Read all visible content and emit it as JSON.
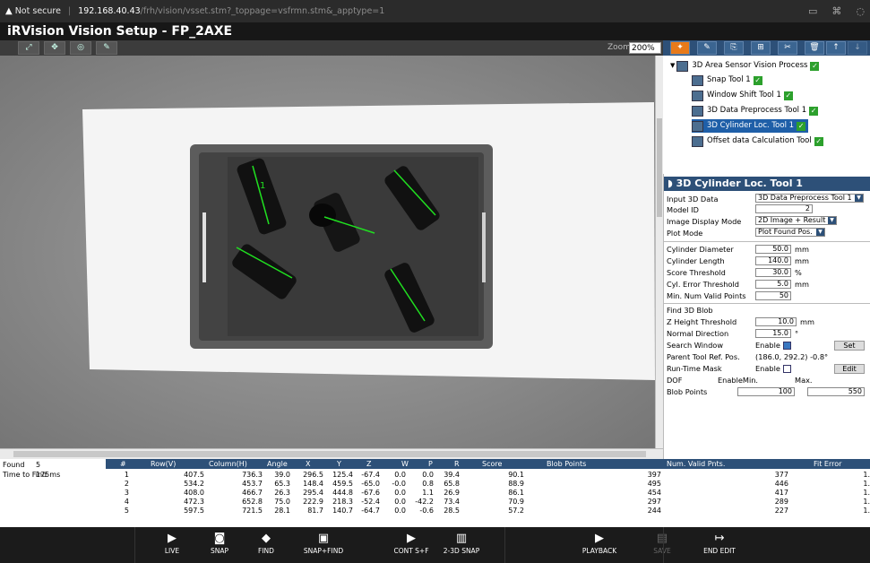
{
  "browser": {
    "not_secure": "Not secure",
    "host": "192.168.40.43",
    "path": "/frh/vision/vsset.stm?_toppage=vsfrmn.stm&_apptype=1"
  },
  "app": {
    "title": "iRVision Vision Setup - FP_2AXE"
  },
  "toolbar": {
    "zoom_label": "Zoom",
    "zoom_value": "200%"
  },
  "tree": {
    "root": "3D Area Sensor Vision Process",
    "items": [
      "Snap Tool 1",
      "Window Shift Tool 1",
      "3D Data Preprocess Tool 1",
      "3D Cylinder Loc. Tool 1",
      "Offset data Calculation Tool"
    ]
  },
  "panel": {
    "title": "3D Cylinder Loc. Tool 1",
    "input_3d_data_label": "Input 3D Data",
    "input_3d_data_value": "3D Data Preprocess Tool 1",
    "model_id_label": "Model ID",
    "model_id_value": "2",
    "image_display_mode_label": "Image Display Mode",
    "image_display_mode_value": "2D Image + Result",
    "plot_mode_label": "Plot Mode",
    "plot_mode_value": "Plot Found Pos.",
    "cyl_diameter_label": "Cylinder Diameter",
    "cyl_diameter_value": "50.0",
    "cyl_length_label": "Cylinder Length",
    "cyl_length_value": "140.0",
    "score_threshold_label": "Score Threshold",
    "score_threshold_value": "30.0",
    "cyl_error_label": "Cyl. Error Threshold",
    "cyl_error_value": "5.0",
    "min_valid_label": "Min. Num Valid Points",
    "min_valid_value": "50",
    "find_3d_blob_label": "Find 3D Blob",
    "z_height_label": "Z Height Threshold",
    "z_height_value": "10.0",
    "normal_dir_label": "Normal Direction",
    "normal_dir_value": "15.0",
    "search_window_label": "Search Window",
    "enable_label": "Enable",
    "set_button": "Set",
    "parent_ref_label": "Parent Tool Ref. Pos.",
    "parent_ref_value": "(186.0, 292.2) -0.8°",
    "runtime_mask_label": "Run-Time Mask",
    "edit_button": "Edit",
    "dof_label": "DOF",
    "enable_min_label": "EnableMin.",
    "max_label": "Max.",
    "blob_points_label": "Blob Points",
    "blob_min_value": "100",
    "blob_max_value": "550",
    "unit_mm": "mm",
    "unit_pct": "%",
    "unit_deg": "°"
  },
  "results": {
    "found_label": "Found",
    "found_value": "5",
    "time_label": "Time to Find",
    "time_value": "175ms",
    "headers": [
      "#",
      "Row(V)",
      "Column(H)",
      "Angle",
      "X",
      "Y",
      "Z",
      "W",
      "P",
      "R",
      "Score",
      "Blob Points",
      "Num. Valid Pnts.",
      "Fit Error"
    ],
    "rows": [
      [
        "1",
        "407.5",
        "736.3",
        "39.0",
        "296.5",
        "125.4",
        "-67.4",
        "0.0",
        "0.0",
        "39.4",
        "90.1",
        "397",
        "377",
        "1."
      ],
      [
        "2",
        "534.2",
        "453.7",
        "65.3",
        "148.4",
        "459.5",
        "-65.0",
        "-0.0",
        "0.8",
        "65.8",
        "88.9",
        "495",
        "446",
        "1."
      ],
      [
        "3",
        "408.0",
        "466.7",
        "26.3",
        "295.4",
        "444.8",
        "-67.6",
        "0.0",
        "1.1",
        "26.9",
        "86.1",
        "454",
        "417",
        "1."
      ],
      [
        "4",
        "472.3",
        "652.8",
        "75.0",
        "222.9",
        "218.3",
        "-52.4",
        "0.0",
        "-42.2",
        "73.4",
        "70.9",
        "297",
        "289",
        "1."
      ],
      [
        "5",
        "597.5",
        "721.5",
        "28.1",
        "81.7",
        "140.7",
        "-64.7",
        "0.0",
        "-0.6",
        "28.5",
        "57.2",
        "244",
        "227",
        "1."
      ]
    ]
  },
  "bottom": {
    "buttons": [
      "LIVE",
      "SNAP",
      "FIND",
      "SNAP+FIND",
      "CONT S+F",
      "2-3D SNAP",
      "PLAYBACK",
      "SAVE",
      "END EDIT"
    ]
  }
}
